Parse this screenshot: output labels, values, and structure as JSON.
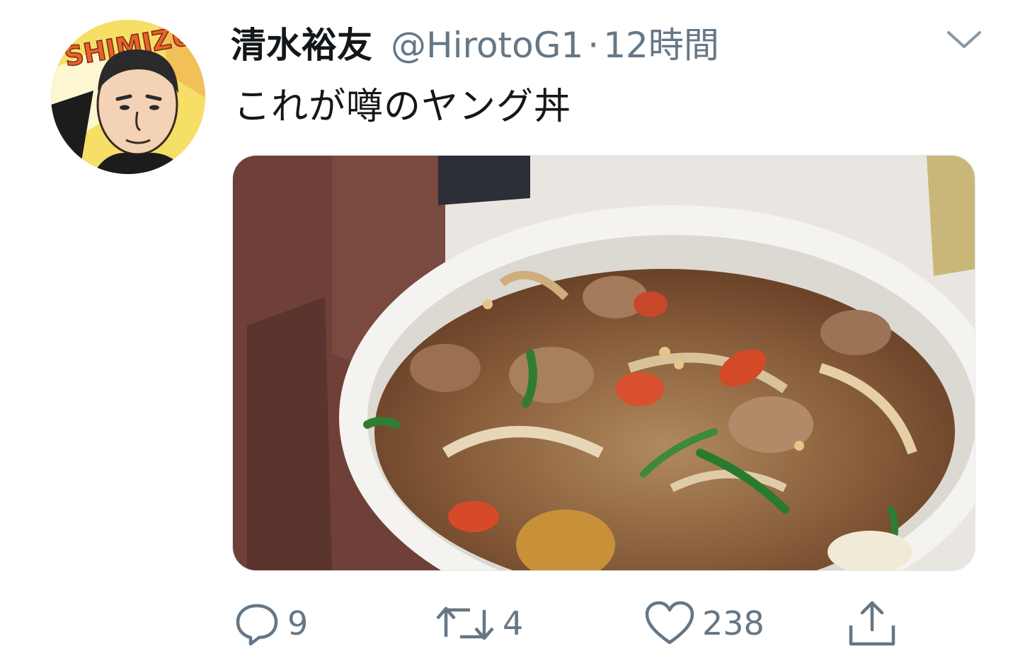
{
  "tweet": {
    "author": {
      "display_name": "清水裕友",
      "handle": "@HirotoG1",
      "separator": "·",
      "time": "12時間",
      "avatar_text": "SHIMIZU"
    },
    "text": "これが噂のヤング丼",
    "media": {
      "description_icon": "food-photo"
    },
    "actions": {
      "reply_count": "9",
      "retweet_count": "4",
      "like_count": "238"
    }
  },
  "colors": {
    "text_primary": "#14171a",
    "text_secondary": "#657786",
    "icon": "#657786",
    "avatar_bg": "#f6df67",
    "avatar_accent": "#e8622c"
  }
}
